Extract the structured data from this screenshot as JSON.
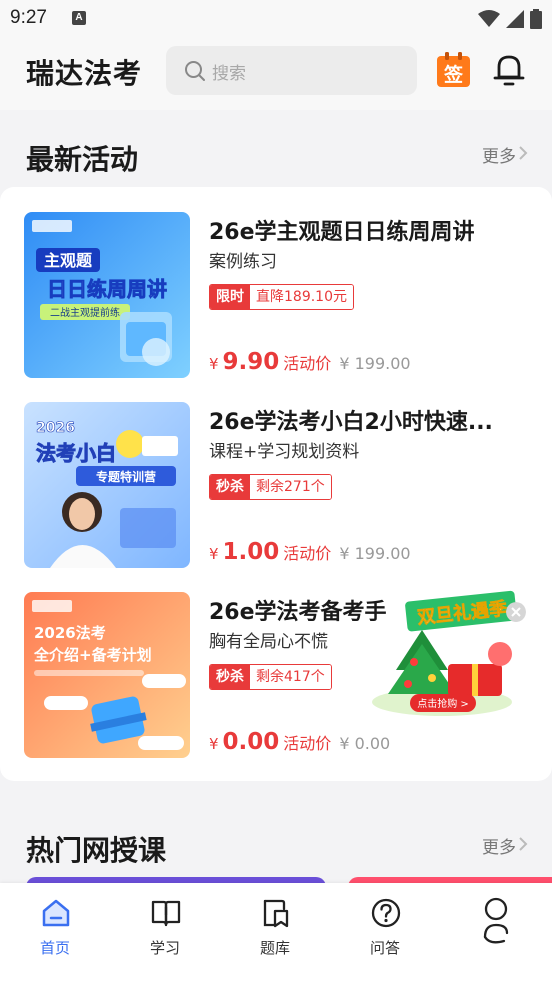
{
  "status": {
    "time": "9:27",
    "notif_glyph": "A"
  },
  "header": {
    "title": "瑞达法考",
    "search_placeholder": "搜索",
    "sign_label": "签"
  },
  "latest": {
    "title": "最新活动",
    "more": "更多",
    "items": [
      {
        "title": "26e学主观题日日练周周讲",
        "subtitle": "案例练习",
        "tag_left": "限时",
        "tag_right": "直降189.10元",
        "yen": "¥",
        "price": "9.90",
        "price_label": "活动价",
        "original": "¥ 199.00",
        "thumb": {
          "line1": "主观题",
          "line2": "日日练周周讲",
          "line3": "二战主观提前练"
        }
      },
      {
        "title": "26e学法考小白2小时快速...",
        "subtitle": "课程+学习规划资料",
        "tag_left": "秒杀",
        "tag_right": "剩余271个",
        "yen": "¥",
        "price": "1.00",
        "price_label": "活动价",
        "original": "¥ 199.00",
        "thumb": {
          "line1": "2026",
          "line2": "法考小白",
          "line3": "专题特训营"
        }
      },
      {
        "title": "26e学法考备考手",
        "subtitle": "胸有全局心不慌",
        "tag_left": "秒杀",
        "tag_right": "剩余417个",
        "yen": "¥",
        "price": "0.00",
        "price_label": "活动价",
        "original": "¥ 0.00",
        "thumb": {
          "line1": "2026法考",
          "line2": "全介绍+备考计划"
        }
      }
    ]
  },
  "promo": {
    "title": "双旦礼遇季",
    "button": "点击抢购 >"
  },
  "hot": {
    "title": "热门网授课",
    "more": "更多"
  },
  "tabs": [
    {
      "label": "首页",
      "icon": "home-icon"
    },
    {
      "label": "学习",
      "icon": "book-icon"
    },
    {
      "label": "题库",
      "icon": "bookmark-icon"
    },
    {
      "label": "问答",
      "icon": "question-icon"
    },
    {
      "label": "",
      "icon": "profile-icon"
    }
  ],
  "colors": {
    "accent": "#e83a3a",
    "tab_active": "#3a6ff0",
    "sign_orange": "#ff7a1a"
  }
}
